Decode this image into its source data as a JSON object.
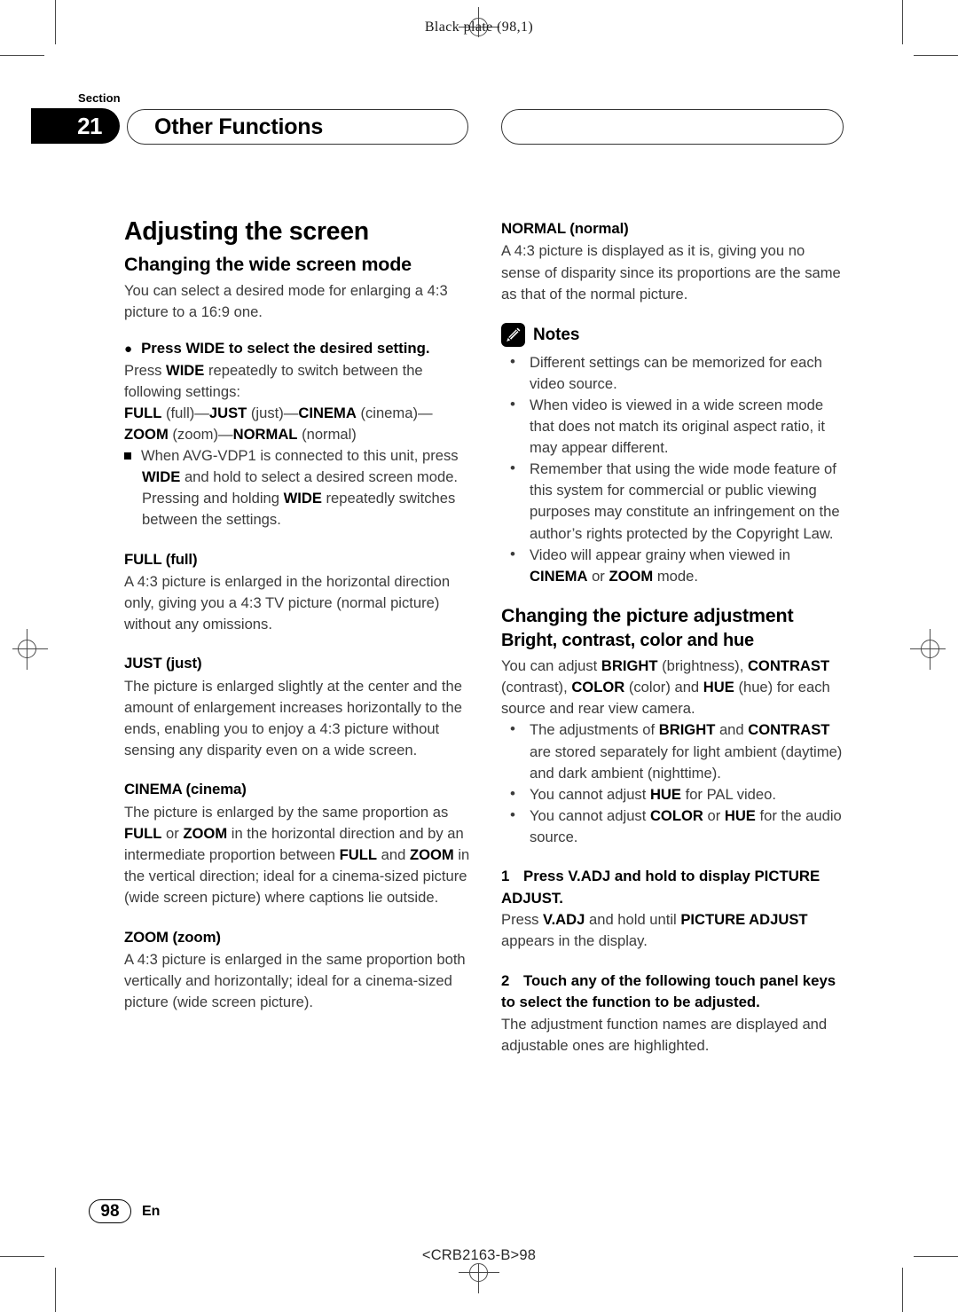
{
  "plate": "Black plate (98,1)",
  "header": {
    "section_label": "Section",
    "section_number": "21",
    "section_title": "Other Functions",
    "right_pill_text": ""
  },
  "left_column": {
    "title": "Adjusting the screen",
    "subtitle": "Changing the wide screen mode",
    "intro": "You can select a desired mode for enlarging a 4:3 picture to a 16:9 one.",
    "instruction_bullet": "●",
    "instruction": "Press WIDE to select the desired setting.",
    "instruction_body_1": "Press ",
    "instruction_body_bold_1": "WIDE",
    "instruction_body_2": " repeatedly to switch between the following settings:",
    "sequence": "FULL (full)—JUST (just)—CINEMA (cinema)—ZOOM (zoom)—NORMAL (normal)",
    "square_note": "When AVG-VDP1 is connected to this unit, press WIDE and hold to select a desired screen mode. Pressing and holding WIDE repeatedly switches between the settings.",
    "modes": [
      {
        "term": "FULL (full)",
        "desc": "A 4:3 picture is enlarged in the horizontal direction only, giving you a 4:3 TV picture (normal picture) without any omissions."
      },
      {
        "term": "JUST (just)",
        "desc": "The picture is enlarged slightly at the center and the amount of enlargement increases horizontally to the ends, enabling you to enjoy a 4:3 picture without sensing any disparity even on a wide screen."
      },
      {
        "term": "CINEMA (cinema)",
        "desc": "The picture is enlarged by the same proportion as FULL or ZOOM in the horizontal direction and by an intermediate proportion between FULL and ZOOM in the vertical direction; ideal for a cinema-sized picture (wide screen picture) where captions lie outside."
      },
      {
        "term": "ZOOM (zoom)",
        "desc": "A 4:3 picture is enlarged in the same proportion both vertically and horizontally; ideal for a cinema-sized picture (wide screen picture)."
      }
    ]
  },
  "right_column": {
    "normal_term": "NORMAL (normal)",
    "normal_desc": "A 4:3 picture is displayed as it is, giving you no sense of disparity since its proportions are the same as that of the normal picture.",
    "notes_icon": "pencil-icon",
    "notes_title": "Notes",
    "notes": [
      "Different settings can be memorized for each video source.",
      "When video is viewed in a wide screen mode that does not match its original aspect ratio, it may appear different.",
      "Remember that using the wide mode feature of this system for commercial or public viewing purposes may constitute an infringement on the author’s rights protected by the Copyright Law.",
      "Video will appear grainy when viewed in CINEMA or ZOOM mode."
    ],
    "adjust_title": "Changing the picture adjustment",
    "adjust_subtitle": "Bright, contrast, color and hue",
    "adjust_intro": "You can adjust BRIGHT (brightness), CONTRAST (contrast), COLOR (color) and HUE (hue) for each source and rear view camera.",
    "adjust_notes": [
      "The adjustments of BRIGHT and CONTRAST are stored separately for light ambient (daytime) and dark ambient (nighttime).",
      "You cannot adjust HUE for PAL video.",
      "You cannot adjust COLOR or HUE for the audio source."
    ],
    "steps": [
      {
        "number": "1",
        "heading": "Press V.ADJ and hold to display PICTURE ADJUST.",
        "body": "Press V.ADJ and hold until PICTURE ADJUST appears in the display."
      },
      {
        "number": "2",
        "heading": "Touch any of the following touch panel keys to select the function to be adjusted.",
        "body": "The adjustment function names are displayed and adjustable ones are highlighted."
      }
    ]
  },
  "footer": {
    "page_number": "98",
    "language": "En",
    "doc_code": "<CRB2163-B>98"
  }
}
